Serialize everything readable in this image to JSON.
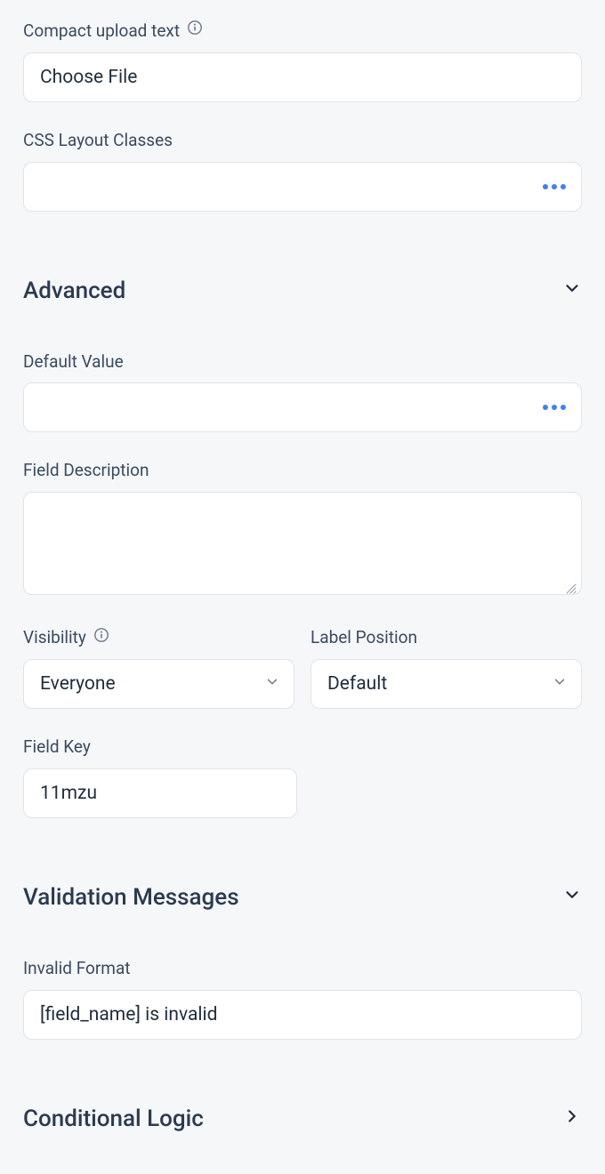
{
  "compact_upload": {
    "label": "Compact upload text",
    "value": "Choose File"
  },
  "css_layout": {
    "label": "CSS Layout Classes",
    "value": ""
  },
  "sections": {
    "advanced": "Advanced",
    "validation_messages": "Validation Messages",
    "conditional_logic": "Conditional Logic"
  },
  "default_value": {
    "label": "Default Value",
    "value": ""
  },
  "field_description": {
    "label": "Field Description",
    "value": ""
  },
  "visibility": {
    "label": "Visibility",
    "value": "Everyone"
  },
  "label_position": {
    "label": "Label Position",
    "value": "Default"
  },
  "field_key": {
    "label": "Field Key",
    "value": "11mzu"
  },
  "invalid_format": {
    "label": "Invalid Format",
    "value": "[field_name] is invalid"
  }
}
